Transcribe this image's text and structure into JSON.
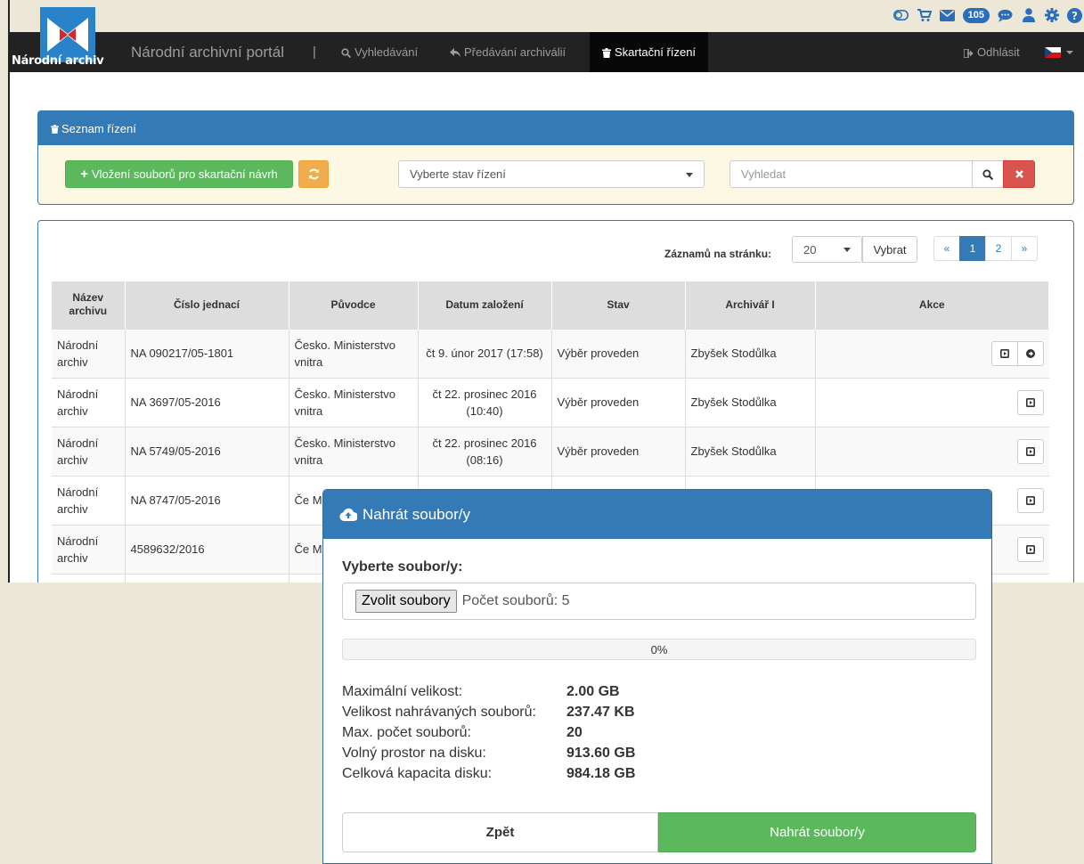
{
  "header": {
    "logo_text": "Národní archiv",
    "brand": "Národní archivní portál",
    "separator": "|",
    "nav": [
      {
        "label": "Vyhledávání"
      },
      {
        "label": "Předávání archiválií"
      },
      {
        "label": "Skartační řízení"
      }
    ],
    "logout": "Odhlásit",
    "message_count": "105",
    "colors": {
      "navbar": "#222222",
      "brand_blue": "#2a83c9"
    }
  },
  "panel_list": {
    "title": "Seznam řízení",
    "upload_button": "Vložení souborů pro skartační návrh",
    "state_select": "Vyberte stav řízení",
    "search_placeholder": "Vyhledat"
  },
  "records": {
    "per_page_label": "Záznamů na stránku:",
    "per_page_value": "20",
    "select_button": "Vybrat",
    "pagination": [
      "«",
      "1",
      "2",
      "»"
    ],
    "columns": [
      "Název archivu",
      "Číslo jednací",
      "Původce",
      "Datum založení",
      "Stav",
      "Archivář I",
      "Akce"
    ],
    "rows": [
      {
        "archive": "Národní archiv",
        "ref": "NA 090217/05-1801",
        "originator": "Česko. Ministerstvo vnitra",
        "date": "čt 9. únor 2017 (17:58)",
        "state": "Výběr proveden",
        "archivist": "Zbyšek Stodůlka"
      },
      {
        "archive": "Národní archiv",
        "ref": "NA 3697/05-2016",
        "originator": "Česko. Ministerstvo vnitra",
        "date": "čt 22. prosinec 2016 (10:40)",
        "state": "Výběr proveden",
        "archivist": "Zbyšek Stodůlka"
      },
      {
        "archive": "Národní archiv",
        "ref": "NA 5749/05-2016",
        "originator": "Česko. Ministerstvo vnitra",
        "date": "čt 22. prosinec 2016 (08:16)",
        "state": "Výběr proveden",
        "archivist": "Zbyšek Stodůlka"
      },
      {
        "archive": "Národní archiv",
        "ref": "NA 8747/05-2016",
        "originator": "Če Mi",
        "date": "",
        "state": "",
        "archivist": ""
      },
      {
        "archive": "Národní archiv",
        "ref": "4589632/2016",
        "originator": "Če Mi",
        "date": "",
        "state": "",
        "archivist": ""
      }
    ]
  },
  "modal": {
    "title": "Nahrát soubor/y",
    "choose_label": "Vyberte soubor/y:",
    "choose_button": "Zvolit soubory",
    "file_count": "Počet souborů: 5",
    "progress_text": "0%",
    "progress_fraction": 0,
    "info": [
      {
        "k": "Maximální velikost:",
        "v": "2.00 GB"
      },
      {
        "k": "Velikost nahrávaných souborů:",
        "v": "237.47 KB"
      },
      {
        "k": "Max. počet souborů:",
        "v": "20"
      },
      {
        "k": "Volný prostor na disku:",
        "v": "913.60 GB"
      },
      {
        "k": "Celková kapacita disku:",
        "v": "984.18 GB"
      }
    ],
    "back_button": "Zpět",
    "upload_button": "Nahrát soubor/y"
  }
}
